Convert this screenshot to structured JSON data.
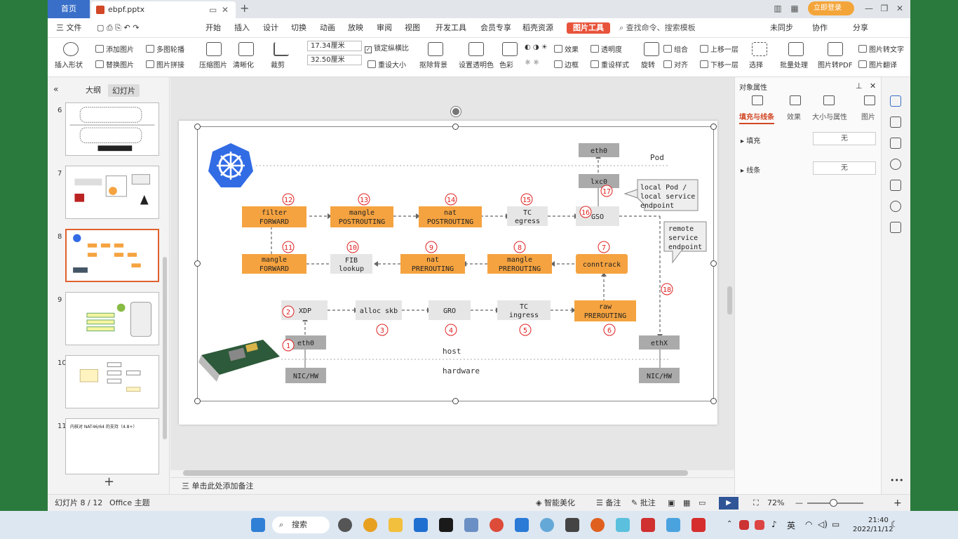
{
  "tabbar": {
    "home": "首页",
    "doc_title": "ebpf.pptx",
    "login": "立即登录"
  },
  "menu": {
    "file": "三 文件",
    "items": [
      "开始",
      "插入",
      "设计",
      "切换",
      "动画",
      "放映",
      "审阅",
      "视图",
      "开发工具",
      "会员专享",
      "稻壳资源"
    ],
    "active_tool": "图片工具",
    "search_placeholder": "查找命令、搜索模板",
    "right_items": [
      "未同步",
      "协作",
      "分享"
    ]
  },
  "ribbon": {
    "insert_shape": "插入形状",
    "add_picture": "添加图片",
    "replace_picture": "替换图片",
    "multi_carousel": "多图轮播",
    "picture_splice": "图片拼接",
    "compress": "压缩图片",
    "clarify": "清晰化",
    "crop": "裁剪",
    "width": "17.34厘米",
    "height": "32.50厘米",
    "lock_ratio": "锁定纵横比",
    "reset_size": "重设大小",
    "remove_bg": "抠除背景",
    "set_transparent": "设置透明色",
    "color": "色彩",
    "effects": "效果",
    "transparency": "透明度",
    "border": "边框",
    "reset_style": "重设样式",
    "rotate": "旋转",
    "group": "组合",
    "align": "对齐",
    "bring_forward": "上移一层",
    "send_backward": "下移一层",
    "select": "选择",
    "batch": "批量处理",
    "to_pdf": "图片转PDF",
    "to_text": "图片转文字",
    "translate": "图片翻译"
  },
  "leftpane": {
    "outline_tab": "大纲",
    "slides_tab": "幻灯片",
    "slide_numbers": [
      "6",
      "7",
      "8",
      "9",
      "10",
      "11"
    ],
    "slide11_text": "内核对 NAT46/64 的支持（4.8+）"
  },
  "diagram": {
    "boxes": {
      "eth0_pod": "eth0",
      "lxc0": "lxc0",
      "pod": "Pod",
      "filter_forward": [
        "filter",
        "FORWARD"
      ],
      "mangle_postrouting": [
        "mangle",
        "POSTROUTING"
      ],
      "nat_postrouting": [
        "nat",
        "POSTROUTING"
      ],
      "tc_egress": [
        "TC",
        "egress"
      ],
      "gso": "GSO",
      "mangle_forward": [
        "mangle",
        "FORWARD"
      ],
      "fib_lookup": [
        "FIB",
        "lookup"
      ],
      "nat_prerouting": [
        "nat",
        "PREROUTING"
      ],
      "mangle_prerouting": [
        "mangle",
        "PREROUTING"
      ],
      "conntrack": "conntrack",
      "xdp": "XDP",
      "alloc_skb": "alloc skb",
      "gro": "GRO",
      "tc_ingress": [
        "TC",
        "ingress"
      ],
      "raw_prerouting": [
        "raw",
        "PREROUTING"
      ],
      "eth0_host": "eth0",
      "ethx": "ethX",
      "nic_hw_left": "NIC/HW",
      "nic_hw_right": "NIC/HW",
      "host": "host",
      "hardware": "hardware"
    },
    "callout_local": [
      "local Pod /",
      "local service",
      "endpoint"
    ],
    "callout_remote": [
      "remote",
      "service",
      "endpoint"
    ],
    "steps": [
      "1",
      "2",
      "3",
      "4",
      "5",
      "6",
      "7",
      "8",
      "9",
      "10",
      "11",
      "12",
      "13",
      "14",
      "15",
      "16",
      "17",
      "18"
    ]
  },
  "notes": "三 单击此处添加备注",
  "rightpanel": {
    "title": "对象属性",
    "tabs": [
      "填充与线条",
      "效果",
      "大小与属性",
      "图片"
    ],
    "fill_label": "填充",
    "fill_value": "无",
    "line_label": "线条",
    "line_value": "无"
  },
  "status": {
    "slide_info": "幻灯片 8 / 12",
    "theme": "Office 主题",
    "smart": "智能美化",
    "notes": "备注",
    "comments": "批注",
    "zoom": "72%"
  },
  "taskbar": {
    "search": "搜索",
    "lang": "英",
    "time": "21:40",
    "date": "2022/11/12"
  },
  "colors": {
    "accent": "#e8543b",
    "orange_box": "#f5a340",
    "gray_box": "#e6e6e6",
    "dark_box": "#999999",
    "step_red": "#e02020",
    "k8s_blue": "#326ce5"
  }
}
